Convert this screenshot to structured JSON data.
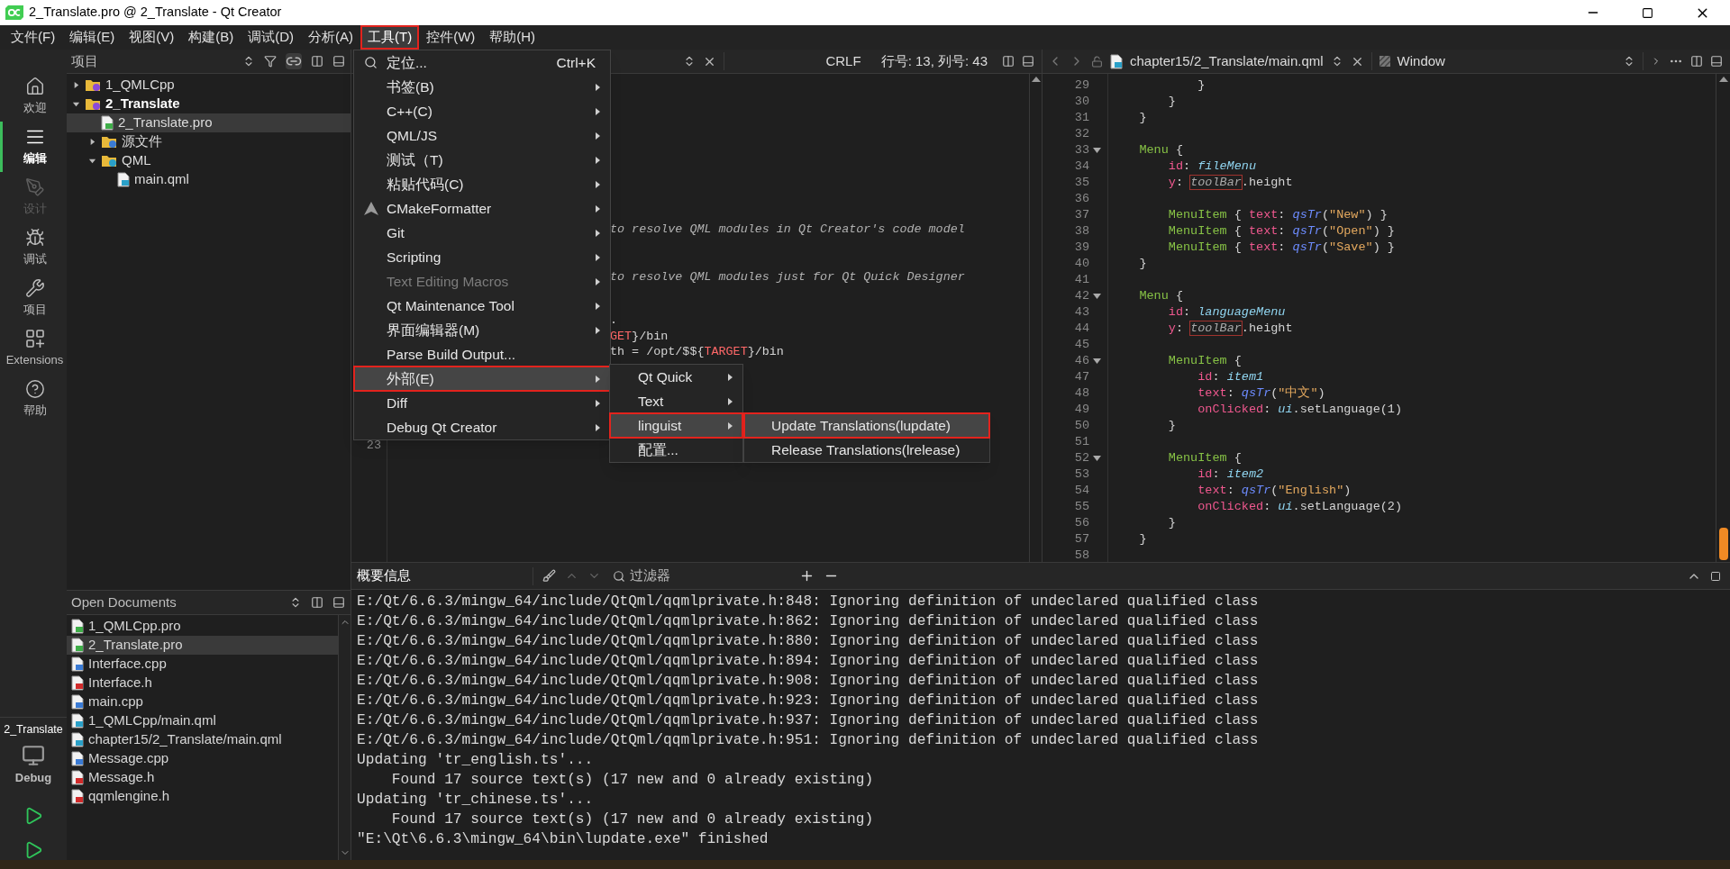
{
  "window": {
    "title": "2_Translate.pro @ 2_Translate - Qt Creator"
  },
  "menu_bar": [
    {
      "label": "文件(F)",
      "selected": false,
      "outlined": false
    },
    {
      "label": "编辑(E)",
      "selected": false,
      "outlined": false
    },
    {
      "label": "视图(V)",
      "selected": false,
      "outlined": false
    },
    {
      "label": "构建(B)",
      "selected": false,
      "outlined": false
    },
    {
      "label": "调试(D)",
      "selected": false,
      "outlined": false
    },
    {
      "label": "分析(A)",
      "selected": false,
      "outlined": false
    },
    {
      "label": "工具(T)",
      "selected": true,
      "outlined": true
    },
    {
      "label": "控件(W)",
      "selected": false,
      "outlined": false
    },
    {
      "label": "帮助(H)",
      "selected": false,
      "outlined": false
    }
  ],
  "mode_bar": {
    "items": [
      {
        "label": "欢迎",
        "kind": "home",
        "selected": false,
        "disabled": false
      },
      {
        "label": "编辑",
        "kind": "edit",
        "selected": true,
        "disabled": false
      },
      {
        "label": "设计",
        "kind": "design",
        "selected": false,
        "disabled": true
      },
      {
        "label": "调试",
        "kind": "debug",
        "selected": false,
        "disabled": false
      },
      {
        "label": "项目",
        "kind": "projects",
        "selected": false,
        "disabled": false
      },
      {
        "label": "Extensions",
        "kind": "extensions",
        "selected": false,
        "disabled": false
      },
      {
        "label": "帮助",
        "kind": "help",
        "selected": false,
        "disabled": false
      }
    ],
    "target": {
      "project": "2_Translate",
      "config": "Debug"
    }
  },
  "projects_panel": {
    "title": "项目",
    "tree": [
      {
        "label": "1_QMLCpp",
        "kind": "project",
        "active": false,
        "expanded": false,
        "selected": false
      },
      {
        "label": "2_Translate",
        "kind": "project",
        "active": true,
        "expanded": true,
        "selected": false,
        "children": [
          {
            "label": "2_Translate.pro",
            "kind": "pro",
            "selected": true
          },
          {
            "label": "源文件",
            "kind": "cpp-folder",
            "expanded": false,
            "selected": false
          },
          {
            "label": "QML",
            "kind": "qml-folder",
            "expanded": true,
            "selected": false,
            "children": [
              {
                "label": "main.qml",
                "kind": "qml",
                "selected": false
              }
            ]
          }
        ]
      }
    ]
  },
  "open_documents": {
    "title": "Open Documents",
    "items": [
      {
        "label": "1_QMLCpp.pro",
        "kind": "pro",
        "selected": false
      },
      {
        "label": "2_Translate.pro",
        "kind": "pro",
        "selected": true
      },
      {
        "label": "Interface.cpp",
        "kind": "cpp",
        "selected": false
      },
      {
        "label": "Interface.h",
        "kind": "h",
        "selected": false
      },
      {
        "label": "main.cpp",
        "kind": "cpp",
        "selected": false
      },
      {
        "label": "1_QMLCpp/main.qml",
        "kind": "qml",
        "selected": false
      },
      {
        "label": "chapter15/2_Translate/main.qml",
        "kind": "qml",
        "selected": false
      },
      {
        "label": "Message.cpp",
        "kind": "cpp",
        "selected": false
      },
      {
        "label": "Message.h",
        "kind": "h",
        "selected": false
      },
      {
        "label": "qqmlengine.h",
        "kind": "h",
        "selected": false
      }
    ]
  },
  "left_editor": {
    "line_ending": "CRLF",
    "position": "行号: 13, 列号: 43",
    "line_number": "23",
    "code": [
      [
        {
          "t": "to resolve QML modules in Qt Creator's code model",
          "kind": "comment"
        }
      ],
      [
        {
          "t": "to resolve QML modules just for Qt Quick Designer",
          "kind": "comment"
        }
      ],
      [
        {
          "t": ".",
          "kind": "plain"
        }
      ],
      [
        {
          "t": "GET",
          "kind": "variable"
        },
        {
          "t": "}/bin",
          "kind": "plain"
        }
      ],
      [
        {
          "t": "th = /opt/$${",
          "kind": "plain"
        },
        {
          "t": "TARGET",
          "kind": "variable"
        },
        {
          "t": "}/bin",
          "kind": "plain"
        }
      ]
    ]
  },
  "right_editor": {
    "file": "chapter15/2_Translate/main.qml",
    "symbol": "Window",
    "lines": [
      {
        "n": "29",
        "fold": false,
        "code": [
          {
            "t": "            }",
            "kind": "plain"
          }
        ]
      },
      {
        "n": "30",
        "fold": false,
        "code": [
          {
            "t": "        }",
            "kind": "plain"
          }
        ]
      },
      {
        "n": "31",
        "fold": false,
        "code": [
          {
            "t": "    }",
            "kind": "plain"
          }
        ]
      },
      {
        "n": "32",
        "fold": false
      },
      {
        "n": "33",
        "fold": true,
        "code": [
          {
            "t": "    Menu",
            "kind": "type"
          },
          {
            "t": " {",
            "kind": "plain"
          }
        ]
      },
      {
        "n": "34",
        "fold": false,
        "code": [
          {
            "t": "        id",
            "kind": "property"
          },
          {
            "t": ": ",
            "kind": "plain"
          },
          {
            "t": "fileMenu",
            "kind": "id"
          }
        ]
      },
      {
        "n": "35",
        "fold": false,
        "code": [
          {
            "t": "        y",
            "kind": "property"
          },
          {
            "t": ": ",
            "kind": "plain"
          },
          {
            "t": "toolBar",
            "kind": "unresolved"
          },
          {
            "t": ".height",
            "kind": "plain"
          }
        ]
      },
      {
        "n": "36",
        "fold": false
      },
      {
        "n": "37",
        "fold": false,
        "code": [
          {
            "t": "        MenuItem",
            "kind": "type"
          },
          {
            "t": " { ",
            "kind": "plain"
          },
          {
            "t": "text",
            "kind": "property"
          },
          {
            "t": ": ",
            "kind": "plain"
          },
          {
            "t": "qsTr",
            "kind": "function"
          },
          {
            "t": "(",
            "kind": "plain"
          },
          {
            "t": "\"New\"",
            "kind": "string"
          },
          {
            "t": ") }",
            "kind": "plain"
          }
        ]
      },
      {
        "n": "38",
        "fold": false,
        "code": [
          {
            "t": "        MenuItem",
            "kind": "type"
          },
          {
            "t": " { ",
            "kind": "plain"
          },
          {
            "t": "text",
            "kind": "property"
          },
          {
            "t": ": ",
            "kind": "plain"
          },
          {
            "t": "qsTr",
            "kind": "function"
          },
          {
            "t": "(",
            "kind": "plain"
          },
          {
            "t": "\"Open\"",
            "kind": "string"
          },
          {
            "t": ") }",
            "kind": "plain"
          }
        ]
      },
      {
        "n": "39",
        "fold": false,
        "code": [
          {
            "t": "        MenuItem",
            "kind": "type"
          },
          {
            "t": " { ",
            "kind": "plain"
          },
          {
            "t": "text",
            "kind": "property"
          },
          {
            "t": ": ",
            "kind": "plain"
          },
          {
            "t": "qsTr",
            "kind": "function"
          },
          {
            "t": "(",
            "kind": "plain"
          },
          {
            "t": "\"Save\"",
            "kind": "string"
          },
          {
            "t": ") }",
            "kind": "plain"
          }
        ]
      },
      {
        "n": "40",
        "fold": false,
        "code": [
          {
            "t": "    }",
            "kind": "plain"
          }
        ]
      },
      {
        "n": "41",
        "fold": false
      },
      {
        "n": "42",
        "fold": true,
        "code": [
          {
            "t": "    Menu",
            "kind": "type"
          },
          {
            "t": " {",
            "kind": "plain"
          }
        ]
      },
      {
        "n": "43",
        "fold": false,
        "code": [
          {
            "t": "        id",
            "kind": "property"
          },
          {
            "t": ": ",
            "kind": "plain"
          },
          {
            "t": "languageMenu",
            "kind": "id"
          }
        ]
      },
      {
        "n": "44",
        "fold": false,
        "code": [
          {
            "t": "        y",
            "kind": "property"
          },
          {
            "t": ": ",
            "kind": "plain"
          },
          {
            "t": "toolBar",
            "kind": "unresolved"
          },
          {
            "t": ".height",
            "kind": "plain"
          }
        ]
      },
      {
        "n": "45",
        "fold": false
      },
      {
        "n": "46",
        "fold": true,
        "code": [
          {
            "t": "        MenuItem",
            "kind": "type"
          },
          {
            "t": " {",
            "kind": "plain"
          }
        ]
      },
      {
        "n": "47",
        "fold": false,
        "code": [
          {
            "t": "            id",
            "kind": "property"
          },
          {
            "t": ": ",
            "kind": "plain"
          },
          {
            "t": "item1",
            "kind": "id"
          }
        ]
      },
      {
        "n": "48",
        "fold": false,
        "code": [
          {
            "t": "            text",
            "kind": "property"
          },
          {
            "t": ": ",
            "kind": "plain"
          },
          {
            "t": "qsTr",
            "kind": "function"
          },
          {
            "t": "(",
            "kind": "plain"
          },
          {
            "t": "\"中文\"",
            "kind": "string"
          },
          {
            "t": ")",
            "kind": "plain"
          }
        ]
      },
      {
        "n": "49",
        "fold": false,
        "code": [
          {
            "t": "            onClicked",
            "kind": "property"
          },
          {
            "t": ": ",
            "kind": "plain"
          },
          {
            "t": "ui",
            "kind": "id"
          },
          {
            "t": ".setLanguage(1)",
            "kind": "plain"
          }
        ]
      },
      {
        "n": "50",
        "fold": false,
        "code": [
          {
            "t": "        }",
            "kind": "plain"
          }
        ]
      },
      {
        "n": "51",
        "fold": false
      },
      {
        "n": "52",
        "fold": true,
        "code": [
          {
            "t": "        MenuItem",
            "kind": "type"
          },
          {
            "t": " {",
            "kind": "plain"
          }
        ]
      },
      {
        "n": "53",
        "fold": false,
        "code": [
          {
            "t": "            id",
            "kind": "property"
          },
          {
            "t": ": ",
            "kind": "plain"
          },
          {
            "t": "item2",
            "kind": "id"
          }
        ]
      },
      {
        "n": "54",
        "fold": false,
        "code": [
          {
            "t": "            text",
            "kind": "property"
          },
          {
            "t": ": ",
            "kind": "plain"
          },
          {
            "t": "qsTr",
            "kind": "function"
          },
          {
            "t": "(",
            "kind": "plain"
          },
          {
            "t": "\"English\"",
            "kind": "string"
          },
          {
            "t": ")",
            "kind": "plain"
          }
        ]
      },
      {
        "n": "55",
        "fold": false,
        "code": [
          {
            "t": "            onClicked",
            "kind": "property"
          },
          {
            "t": ": ",
            "kind": "plain"
          },
          {
            "t": "ui",
            "kind": "id"
          },
          {
            "t": ".setLanguage(2)",
            "kind": "plain"
          }
        ]
      },
      {
        "n": "56",
        "fold": false,
        "code": [
          {
            "t": "        }",
            "kind": "plain"
          }
        ]
      },
      {
        "n": "57",
        "fold": false,
        "code": [
          {
            "t": "    }",
            "kind": "plain"
          }
        ]
      },
      {
        "n": "58",
        "fold": false
      }
    ]
  },
  "output": {
    "title": "概要信息",
    "filter": {
      "placeholder": "过滤器"
    },
    "lines": [
      "E:/Qt/6.6.3/mingw_64/include/QtQml/qqmlprivate.h:848: Ignoring definition of undeclared qualified class",
      "E:/Qt/6.6.3/mingw_64/include/QtQml/qqmlprivate.h:862: Ignoring definition of undeclared qualified class",
      "E:/Qt/6.6.3/mingw_64/include/QtQml/qqmlprivate.h:880: Ignoring definition of undeclared qualified class",
      "E:/Qt/6.6.3/mingw_64/include/QtQml/qqmlprivate.h:894: Ignoring definition of undeclared qualified class",
      "E:/Qt/6.6.3/mingw_64/include/QtQml/qqmlprivate.h:908: Ignoring definition of undeclared qualified class",
      "E:/Qt/6.6.3/mingw_64/include/QtQml/qqmlprivate.h:923: Ignoring definition of undeclared qualified class",
      "E:/Qt/6.6.3/mingw_64/include/QtQml/qqmlprivate.h:937: Ignoring definition of undeclared qualified class",
      "E:/Qt/6.6.3/mingw_64/include/QtQml/qqmlprivate.h:951: Ignoring definition of undeclared qualified class",
      "Updating 'tr_english.ts'...",
      "    Found 17 source text(s) (17 new and 0 already existing)",
      "Updating 'tr_chinese.ts'...",
      "    Found 17 source text(s) (17 new and 0 already existing)",
      "\"E:\\Qt\\6.6.3\\mingw_64\\bin\\lupdate.exe\" finished"
    ]
  },
  "tools_menu": {
    "items": [
      {
        "label": "定位...",
        "shortcut": "Ctrl+K",
        "submenu": false,
        "disabled": false,
        "selected": false,
        "outlined": false
      },
      {
        "label": "书签(B)",
        "submenu": true,
        "disabled": false,
        "selected": false,
        "outlined": false
      },
      {
        "label": "C++(C)",
        "submenu": true,
        "disabled": false,
        "selected": false,
        "outlined": false
      },
      {
        "label": "QML/JS",
        "submenu": true,
        "disabled": false,
        "selected": false,
        "outlined": false
      },
      {
        "label": "测试（T)",
        "submenu": true,
        "disabled": false,
        "selected": false,
        "outlined": false
      },
      {
        "label": "粘贴代码(C)",
        "submenu": true,
        "disabled": false,
        "selected": false,
        "outlined": false
      },
      {
        "label": "CMakeFormatter",
        "submenu": true,
        "disabled": false,
        "selected": false,
        "outlined": false
      },
      {
        "label": "Git",
        "submenu": true,
        "disabled": false,
        "selected": false,
        "outlined": false
      },
      {
        "label": "Scripting",
        "submenu": true,
        "disabled": false,
        "selected": false,
        "outlined": false
      },
      {
        "label": "Text Editing Macros",
        "submenu": true,
        "disabled": true,
        "selected": false,
        "outlined": false
      },
      {
        "label": "Qt Maintenance Tool",
        "submenu": true,
        "disabled": false,
        "selected": false,
        "outlined": false
      },
      {
        "label": "界面编辑器(M)",
        "submenu": true,
        "disabled": false,
        "selected": false,
        "outlined": false
      },
      {
        "label": "Parse Build Output...",
        "submenu": false,
        "disabled": false,
        "selected": false,
        "outlined": false
      },
      {
        "label": "外部(E)",
        "submenu": true,
        "disabled": false,
        "selected": true,
        "outlined": true
      },
      {
        "label": "Diff",
        "submenu": true,
        "disabled": false,
        "selected": false,
        "outlined": false
      },
      {
        "label": "Debug Qt Creator",
        "submenu": true,
        "disabled": false,
        "selected": false,
        "outlined": false
      }
    ]
  },
  "external_menu": {
    "items": [
      {
        "label": "Qt Quick",
        "submenu": true,
        "selected": false,
        "outlined": false
      },
      {
        "label": "Text",
        "submenu": true,
        "selected": false,
        "outlined": false
      },
      {
        "label": "linguist",
        "submenu": true,
        "selected": true,
        "outlined": true
      },
      {
        "label": "配置...",
        "submenu": false,
        "selected": false,
        "outlined": false
      }
    ]
  },
  "linguist_menu": {
    "items": [
      {
        "label": "Update Translations(lupdate)",
        "selected": true,
        "outlined": true
      },
      {
        "label": "Release Translations(lrelease)",
        "selected": false,
        "outlined": false
      }
    ]
  }
}
